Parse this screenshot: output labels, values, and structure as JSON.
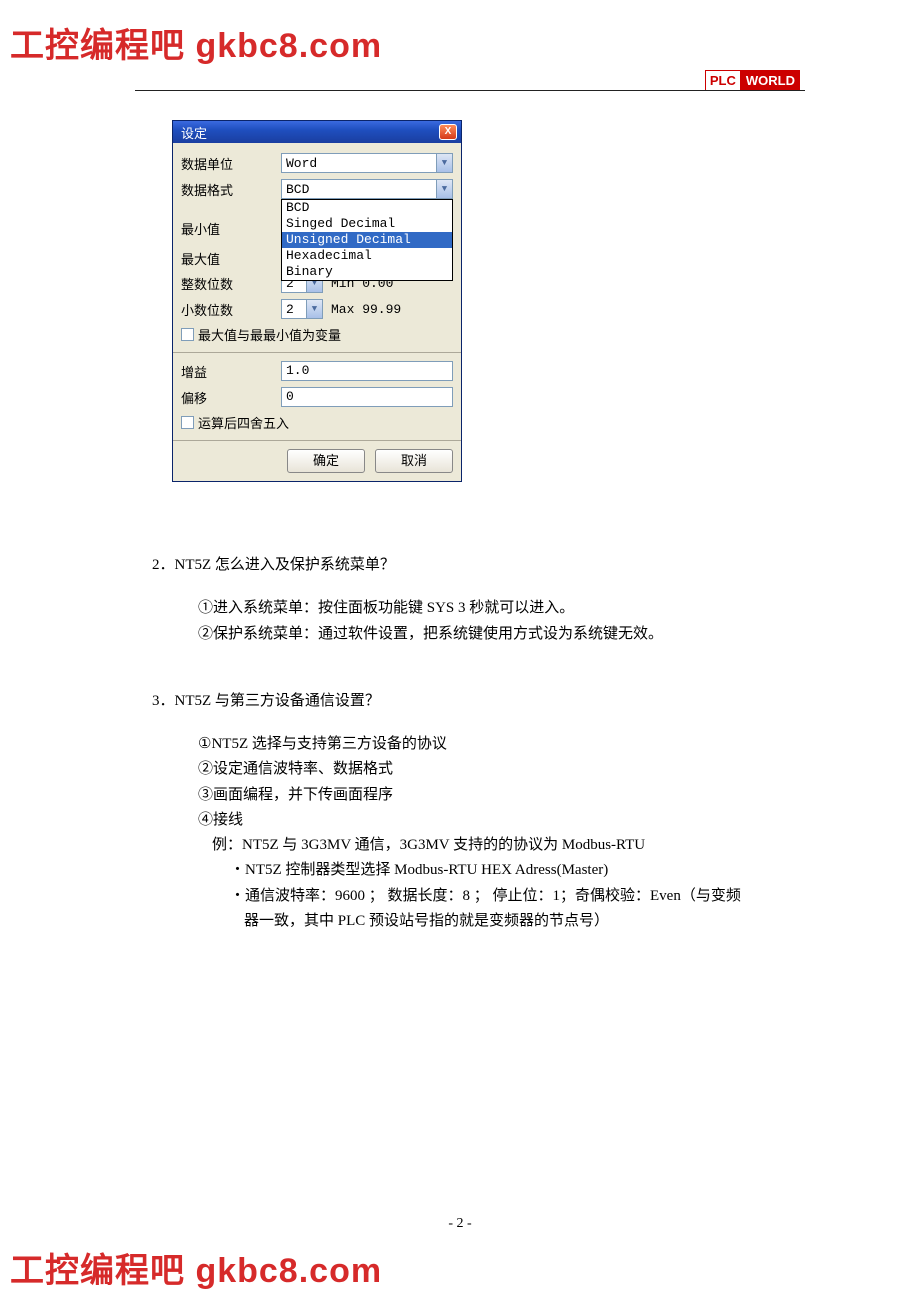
{
  "watermark_text": "工控编程吧  gkbc8.com",
  "logo": {
    "left": "PLC",
    "right": "WORLD"
  },
  "dialog": {
    "title": "设定",
    "close": "X",
    "labels": {
      "data_unit": "数据单位",
      "data_format": "数据格式",
      "min_value": "最小值",
      "max_value": "最大值",
      "int_digits": "整数位数",
      "dec_digits": "小数位数",
      "var_minmax": "最大值与最最小值为变量",
      "gain": "增益",
      "offset": "偏移",
      "round": "运算后四舍五入"
    },
    "values": {
      "data_unit": "Word",
      "data_format": "BCD",
      "int_digits": "2",
      "dec_digits": "2",
      "min_label": "Min 0.00",
      "max_label": "Max 99.99",
      "gain": "1.0",
      "offset": "0"
    },
    "format_options": [
      "BCD",
      "Singed Decimal",
      "Unsigned Decimal",
      "Hexadecimal",
      "Binary"
    ],
    "format_selected_index": 2,
    "buttons": {
      "ok": "确定",
      "cancel": "取消"
    }
  },
  "qa": {
    "q2": {
      "title": "2．NT5Z 怎么进入及保护系统菜单？",
      "lines": [
        "①进入系统菜单：按住面板功能键 SYS 3 秒就可以进入。",
        "②保护系统菜单：通过软件设置，把系统键使用方式设为系统键无效。"
      ]
    },
    "q3": {
      "title": "3．NT5Z 与第三方设备通信设置？",
      "lines": [
        "①NT5Z 选择与支持第三方设备的协议",
        "②设定通信波特率、数据格式",
        "③画面编程，并下传画面程序",
        "④接线"
      ],
      "sub": [
        "例：NT5Z 与 3G3MV 通信，3G3MV 支持的的协议为 Modbus-RTU",
        "・NT5Z 控制器类型选择 Modbus-RTU HEX Adress(Master)",
        "・通信波特率：9600 ；  数据长度：8 ；  停止位：1；奇偶校验：Even（与变频",
        "  器一致，其中 PLC 预设站号指的就是变频器的节点号）"
      ]
    }
  },
  "page_number": "- 2 -"
}
